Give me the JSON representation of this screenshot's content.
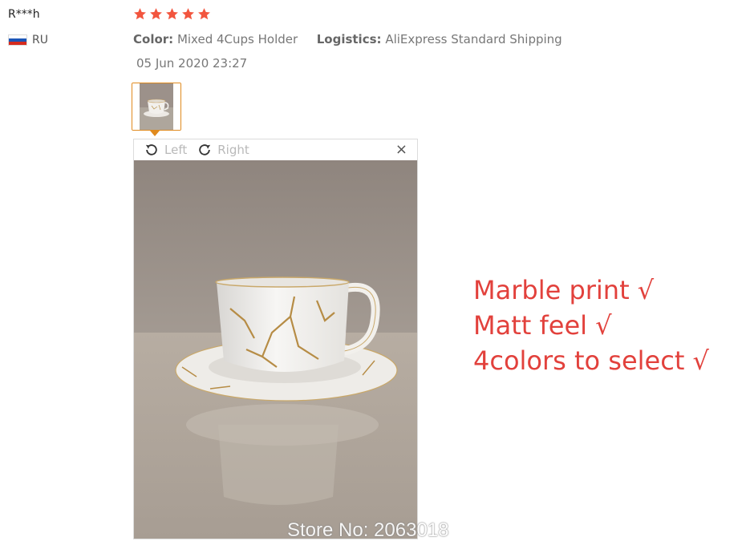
{
  "review": {
    "user_name": "R***h",
    "country_code": "RU",
    "rating_stars": 5,
    "color_label": "Color:",
    "color_value": "Mixed 4Cups Holder",
    "logistics_label": "Logistics:",
    "logistics_value": "AliExpress Standard Shipping",
    "date": "05 Jun 2020 23:27"
  },
  "viewer": {
    "rotate_left_label": "Left",
    "rotate_right_label": "Right",
    "close_symbol": "×"
  },
  "annotation": {
    "lines": [
      "Marble print √",
      "Matt feel √",
      "4colors to select √"
    ],
    "color": "#e2413c"
  },
  "watermark": "Store No: 2063018",
  "colors": {
    "star": "#f2553e",
    "thumb_border": "#e08a1e",
    "meta_text": "#777777"
  },
  "icons": [
    "star-icon",
    "russia-flag-icon",
    "rotate-left-icon",
    "rotate-right-icon",
    "close-icon"
  ]
}
